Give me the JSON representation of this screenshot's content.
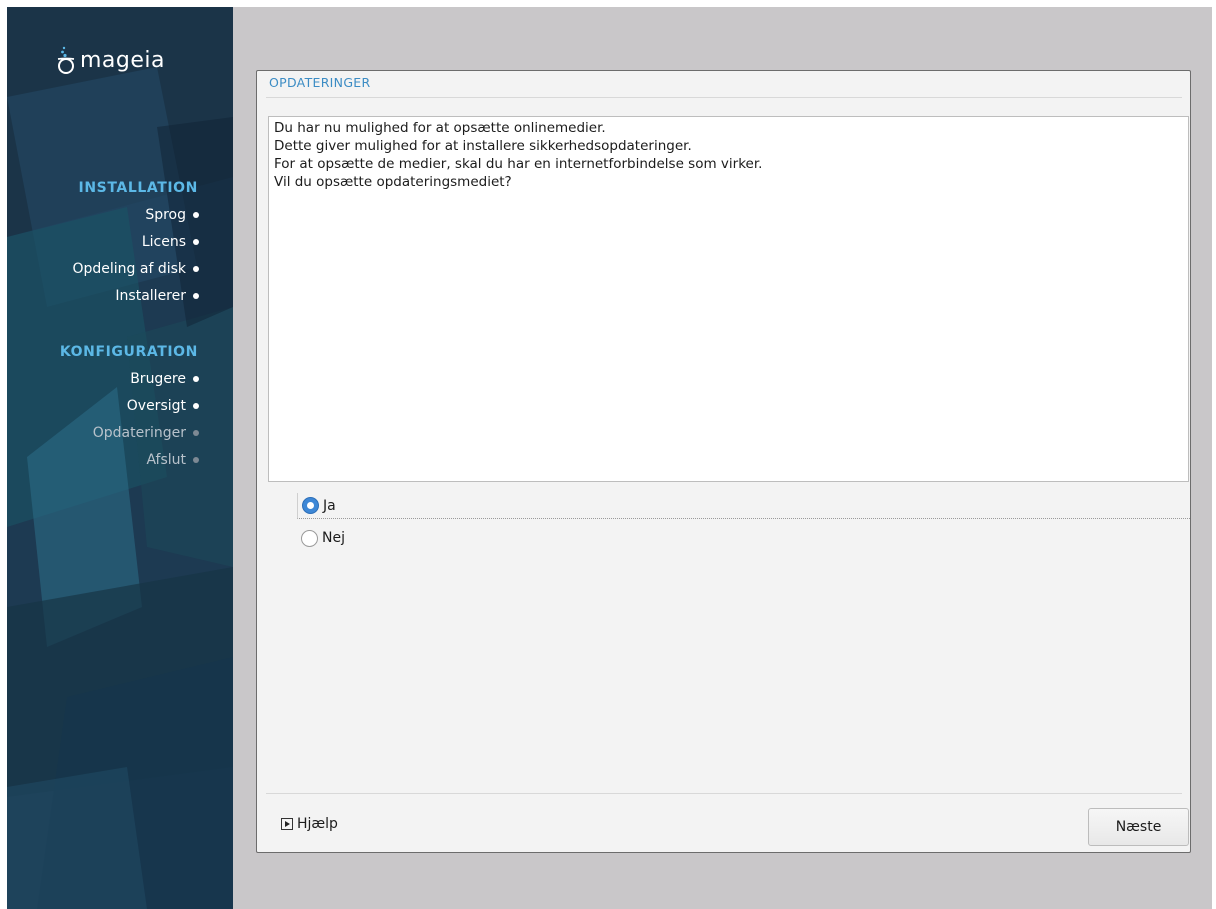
{
  "brand": {
    "logo_text": "mageia"
  },
  "sidebar": {
    "sections": [
      {
        "heading": "INSTALLATION",
        "items": [
          {
            "label": "Sprog",
            "status": "done"
          },
          {
            "label": "Licens",
            "status": "done"
          },
          {
            "label": "Opdeling af disk",
            "status": "done"
          },
          {
            "label": "Installerer",
            "status": "done"
          }
        ]
      },
      {
        "heading": "KONFIGURATION",
        "items": [
          {
            "label": "Brugere",
            "status": "done"
          },
          {
            "label": "Oversigt",
            "status": "done"
          },
          {
            "label": "Opdateringer",
            "status": "current"
          },
          {
            "label": "Afslut",
            "status": "pending"
          }
        ]
      }
    ]
  },
  "panel": {
    "title": "OPDATERINGER",
    "message_lines": [
      "Du har nu mulighed for at opsætte onlinemedier.",
      "Dette giver mulighed for at installere sikkerhedsopdateringer.",
      "For at opsætte de medier, skal du har en internetforbindelse som virker.",
      "Vil du opsætte opdateringsmediet?"
    ],
    "options": [
      {
        "label": "Ja",
        "selected": true
      },
      {
        "label": "Nej",
        "selected": false
      }
    ],
    "help_label": "Hjælp",
    "next_label": "Næste"
  },
  "colors": {
    "accent": "#3c8cc4",
    "heading": "#5cb8e6",
    "radio_selected": "#3d87d6",
    "sidebar_bg": "#1e3a52",
    "desktop_bg": "#c9c7c9"
  }
}
